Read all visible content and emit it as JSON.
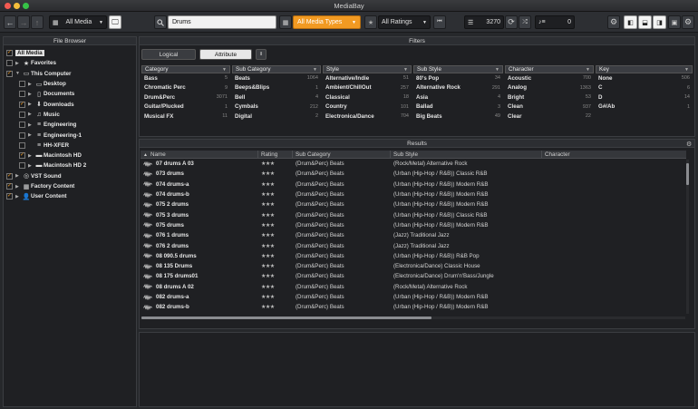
{
  "window": {
    "title": "MediaBay"
  },
  "toolbar": {
    "back_icon": "←",
    "forward_icon": "→",
    "up_icon": "↑",
    "media_selector": "All Media",
    "search_value": "Drums",
    "media_types": "All Media Types",
    "ratings": "All Ratings",
    "results_count": "3270",
    "volume_value": "0"
  },
  "file_browser": {
    "title": "File Browser",
    "items": [
      {
        "label": "All Media",
        "indent": 0,
        "checked": true,
        "arrow": "",
        "icon": ""
      },
      {
        "label": "Favorites",
        "indent": 0,
        "checked": false,
        "arrow": "▶",
        "icon": "★"
      },
      {
        "label": "This Computer",
        "indent": 0,
        "checked": true,
        "arrow": "▼",
        "icon": "▭"
      },
      {
        "label": "Desktop",
        "indent": 1,
        "checked": false,
        "arrow": "▶",
        "icon": "▭"
      },
      {
        "label": "Documents",
        "indent": 1,
        "checked": false,
        "arrow": "▶",
        "icon": "▯"
      },
      {
        "label": "Downloads",
        "indent": 1,
        "checked": true,
        "arrow": "▶",
        "icon": "⬇"
      },
      {
        "label": "Music",
        "indent": 1,
        "checked": false,
        "arrow": "▶",
        "icon": "♫"
      },
      {
        "label": "Engineering",
        "indent": 1,
        "checked": false,
        "arrow": "▶",
        "icon": "≡"
      },
      {
        "label": "Engineering-1",
        "indent": 1,
        "checked": false,
        "arrow": "▶",
        "icon": "≡"
      },
      {
        "label": "HH-XFER",
        "indent": 1,
        "checked": false,
        "arrow": "",
        "icon": "≡"
      },
      {
        "label": "Macintosh HD",
        "indent": 1,
        "checked": true,
        "arrow": "▶",
        "icon": "▬"
      },
      {
        "label": "Macintosh HD 2",
        "indent": 1,
        "checked": false,
        "arrow": "▶",
        "icon": "▬"
      },
      {
        "label": "VST Sound",
        "indent": 0,
        "checked": true,
        "arrow": "▶",
        "icon": "◎"
      },
      {
        "label": "Factory Content",
        "indent": 0,
        "checked": true,
        "arrow": "▶",
        "icon": "▦"
      },
      {
        "label": "User Content",
        "indent": 0,
        "checked": true,
        "arrow": "▶",
        "icon": "👤"
      }
    ]
  },
  "filters": {
    "title": "Filters",
    "tab_logical": "Logical",
    "tab_attribute": "Attribute",
    "columns": [
      {
        "header": "Category",
        "rows": [
          [
            "Bass",
            "5"
          ],
          [
            "Chromatic Perc",
            "9"
          ],
          [
            "Drum&Perc",
            "3071"
          ],
          [
            "Guitar/Plucked",
            "1"
          ],
          [
            "Musical FX",
            "11"
          ]
        ]
      },
      {
        "header": "Sub Category",
        "rows": [
          [
            "Beats",
            "1064"
          ],
          [
            "Beeps&Blips",
            "1"
          ],
          [
            "Bell",
            "4"
          ],
          [
            "Cymbals",
            "212"
          ],
          [
            "Digital",
            "2"
          ]
        ]
      },
      {
        "header": "Style",
        "rows": [
          [
            "Alternative/Indie",
            "51"
          ],
          [
            "Ambient/ChillOut",
            "257"
          ],
          [
            "Classical",
            "18"
          ],
          [
            "Country",
            "101"
          ],
          [
            "Electronica/Dance",
            "704"
          ]
        ]
      },
      {
        "header": "Sub Style",
        "rows": [
          [
            "80's Pop",
            "34"
          ],
          [
            "Alternative Rock",
            "291"
          ],
          [
            "Asia",
            "4"
          ],
          [
            "Ballad",
            "3"
          ],
          [
            "Big Beats",
            "49"
          ]
        ]
      },
      {
        "header": "Character",
        "rows": [
          [
            "Acoustic",
            "700"
          ],
          [
            "Analog",
            "1363"
          ],
          [
            "Bright",
            "53"
          ],
          [
            "Clean",
            "937"
          ],
          [
            "Clear",
            "22"
          ]
        ]
      },
      {
        "header": "Key",
        "rows": [
          [
            "None",
            "506"
          ],
          [
            "C",
            "6"
          ],
          [
            "D",
            "14"
          ],
          [
            "G#/Ab",
            "1"
          ],
          [
            "",
            ""
          ]
        ]
      }
    ]
  },
  "results": {
    "title": "Results",
    "columns": [
      "Name",
      "Rating",
      "Sub Category",
      "Sub Style",
      "Character"
    ],
    "rows": [
      [
        "07 drums A 03",
        "★★★",
        "(Drum&Perc) Beats",
        "(Rock/Metal) Alternative Rock",
        ""
      ],
      [
        "073 drums",
        "★★★",
        "(Drum&Perc) Beats",
        "(Urban (Hip-Hop / R&B)) Classic R&B",
        ""
      ],
      [
        "074 drums-a",
        "★★★",
        "(Drum&Perc) Beats",
        "(Urban (Hip-Hop / R&B)) Modern R&B",
        ""
      ],
      [
        "074 drums-b",
        "★★★",
        "(Drum&Perc) Beats",
        "(Urban (Hip-Hop / R&B)) Modern R&B",
        ""
      ],
      [
        "075 2 drums",
        "★★★",
        "(Drum&Perc) Beats",
        "(Urban (Hip-Hop / R&B)) Modern R&B",
        ""
      ],
      [
        "075 3 drums",
        "★★★",
        "(Drum&Perc) Beats",
        "(Urban (Hip-Hop / R&B)) Classic R&B",
        ""
      ],
      [
        "075 drums",
        "★★★",
        "(Drum&Perc) Beats",
        "(Urban (Hip-Hop / R&B)) Modern R&B",
        ""
      ],
      [
        "076 1 drums",
        "★★★",
        "(Drum&Perc) Beats",
        "(Jazz) Traditional Jazz",
        ""
      ],
      [
        "076 2 drums",
        "★★★",
        "(Drum&Perc) Beats",
        "(Jazz) Traditional Jazz",
        ""
      ],
      [
        "08 090.5 drums",
        "★★★",
        "(Drum&Perc) Beats",
        "(Urban (Hip-Hop / R&B)) R&B Pop",
        ""
      ],
      [
        "08 135 Drums",
        "★★★",
        "(Drum&Perc) Beats",
        "(Electronica/Dance) Classic House",
        ""
      ],
      [
        "08 175 drums01",
        "★★★",
        "(Drum&Perc) Beats",
        "(Electronica/Dance) Drum'n'Bass/Jungle",
        ""
      ],
      [
        "08 drums A 02",
        "★★★",
        "(Drum&Perc) Beats",
        "(Rock/Metal) Alternative Rock",
        ""
      ],
      [
        "082 drums-a",
        "★★★",
        "(Drum&Perc) Beats",
        "(Urban (Hip-Hop / R&B)) Modern R&B",
        ""
      ],
      [
        "082 drums-b",
        "★★★",
        "(Drum&Perc) Beats",
        "(Urban (Hip-Hop / R&B)) Modern R&B",
        ""
      ]
    ]
  },
  "colors": {
    "accent_orange": "#f29a22",
    "panel_bg": "#1f2023",
    "toolbar_bg": "#2d2f33"
  }
}
